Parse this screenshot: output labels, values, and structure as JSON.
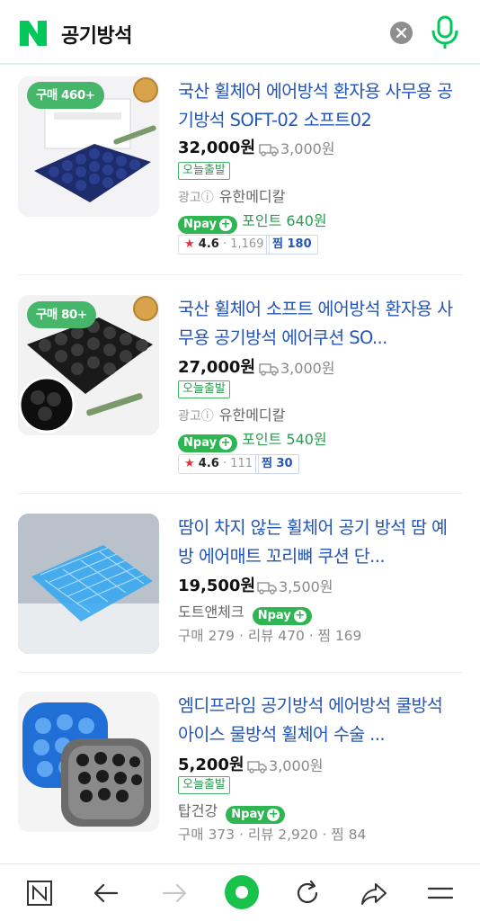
{
  "header": {
    "query": "공기방석",
    "logo_letter": "N",
    "brand_color": "#03c75a"
  },
  "products": [
    {
      "buy_badge": "구매 460+",
      "title": "국산 휠체어 에어방석 환자용 사무용 공기방석 SOFT-02 소프트02",
      "price": "32,000",
      "won": "원",
      "shipping": "3,000원",
      "today_tag": "오늘출발",
      "ad_label": "광고ⓘ",
      "seller": "유한메디칼",
      "npay_label": "pay",
      "point": "포인트 640원",
      "rating": "4.6",
      "rating_count": "1,169",
      "zzim": "찜 180"
    },
    {
      "buy_badge": "구매 80+",
      "title": "국산 휠체어 소프트 에어방석 환자용 사무용 공기방석 에어쿠션 SO...",
      "price": "27,000",
      "won": "원",
      "shipping": "3,000원",
      "today_tag": "오늘출발",
      "ad_label": "광고ⓘ",
      "seller": "유한메디칼",
      "npay_label": "pay",
      "point": "포인트 540원",
      "rating": "4.6",
      "rating_count": "111",
      "zzim": "찜 30"
    },
    {
      "title": "땀이 차지 않는 휠체어 공기 방석 땀 예방 에어매트 꼬리뼈 쿠션 단...",
      "price": "19,500",
      "won": "원",
      "shipping": "3,500원",
      "seller": "도트앤체크",
      "npay_label": "pay",
      "stats": "구매 279 · 리뷰 470 · 찜 169"
    },
    {
      "title": "엠디프라임 공기방석 에어방석 쿨방석 아이스 물방석 휠체어 수술 ...",
      "price": "5,200",
      "won": "원",
      "shipping": "3,000원",
      "today_tag": "오늘출발",
      "seller": "탑건강",
      "npay_label": "pay",
      "stats": "구매 373 · 리뷰 2,920 · 찜 84"
    }
  ],
  "toolbar": {
    "icons": [
      "naver-home-icon",
      "back-arrow-icon",
      "forward-arrow-icon",
      "green-dot-icon",
      "refresh-icon",
      "share-icon",
      "menu-icon"
    ]
  }
}
